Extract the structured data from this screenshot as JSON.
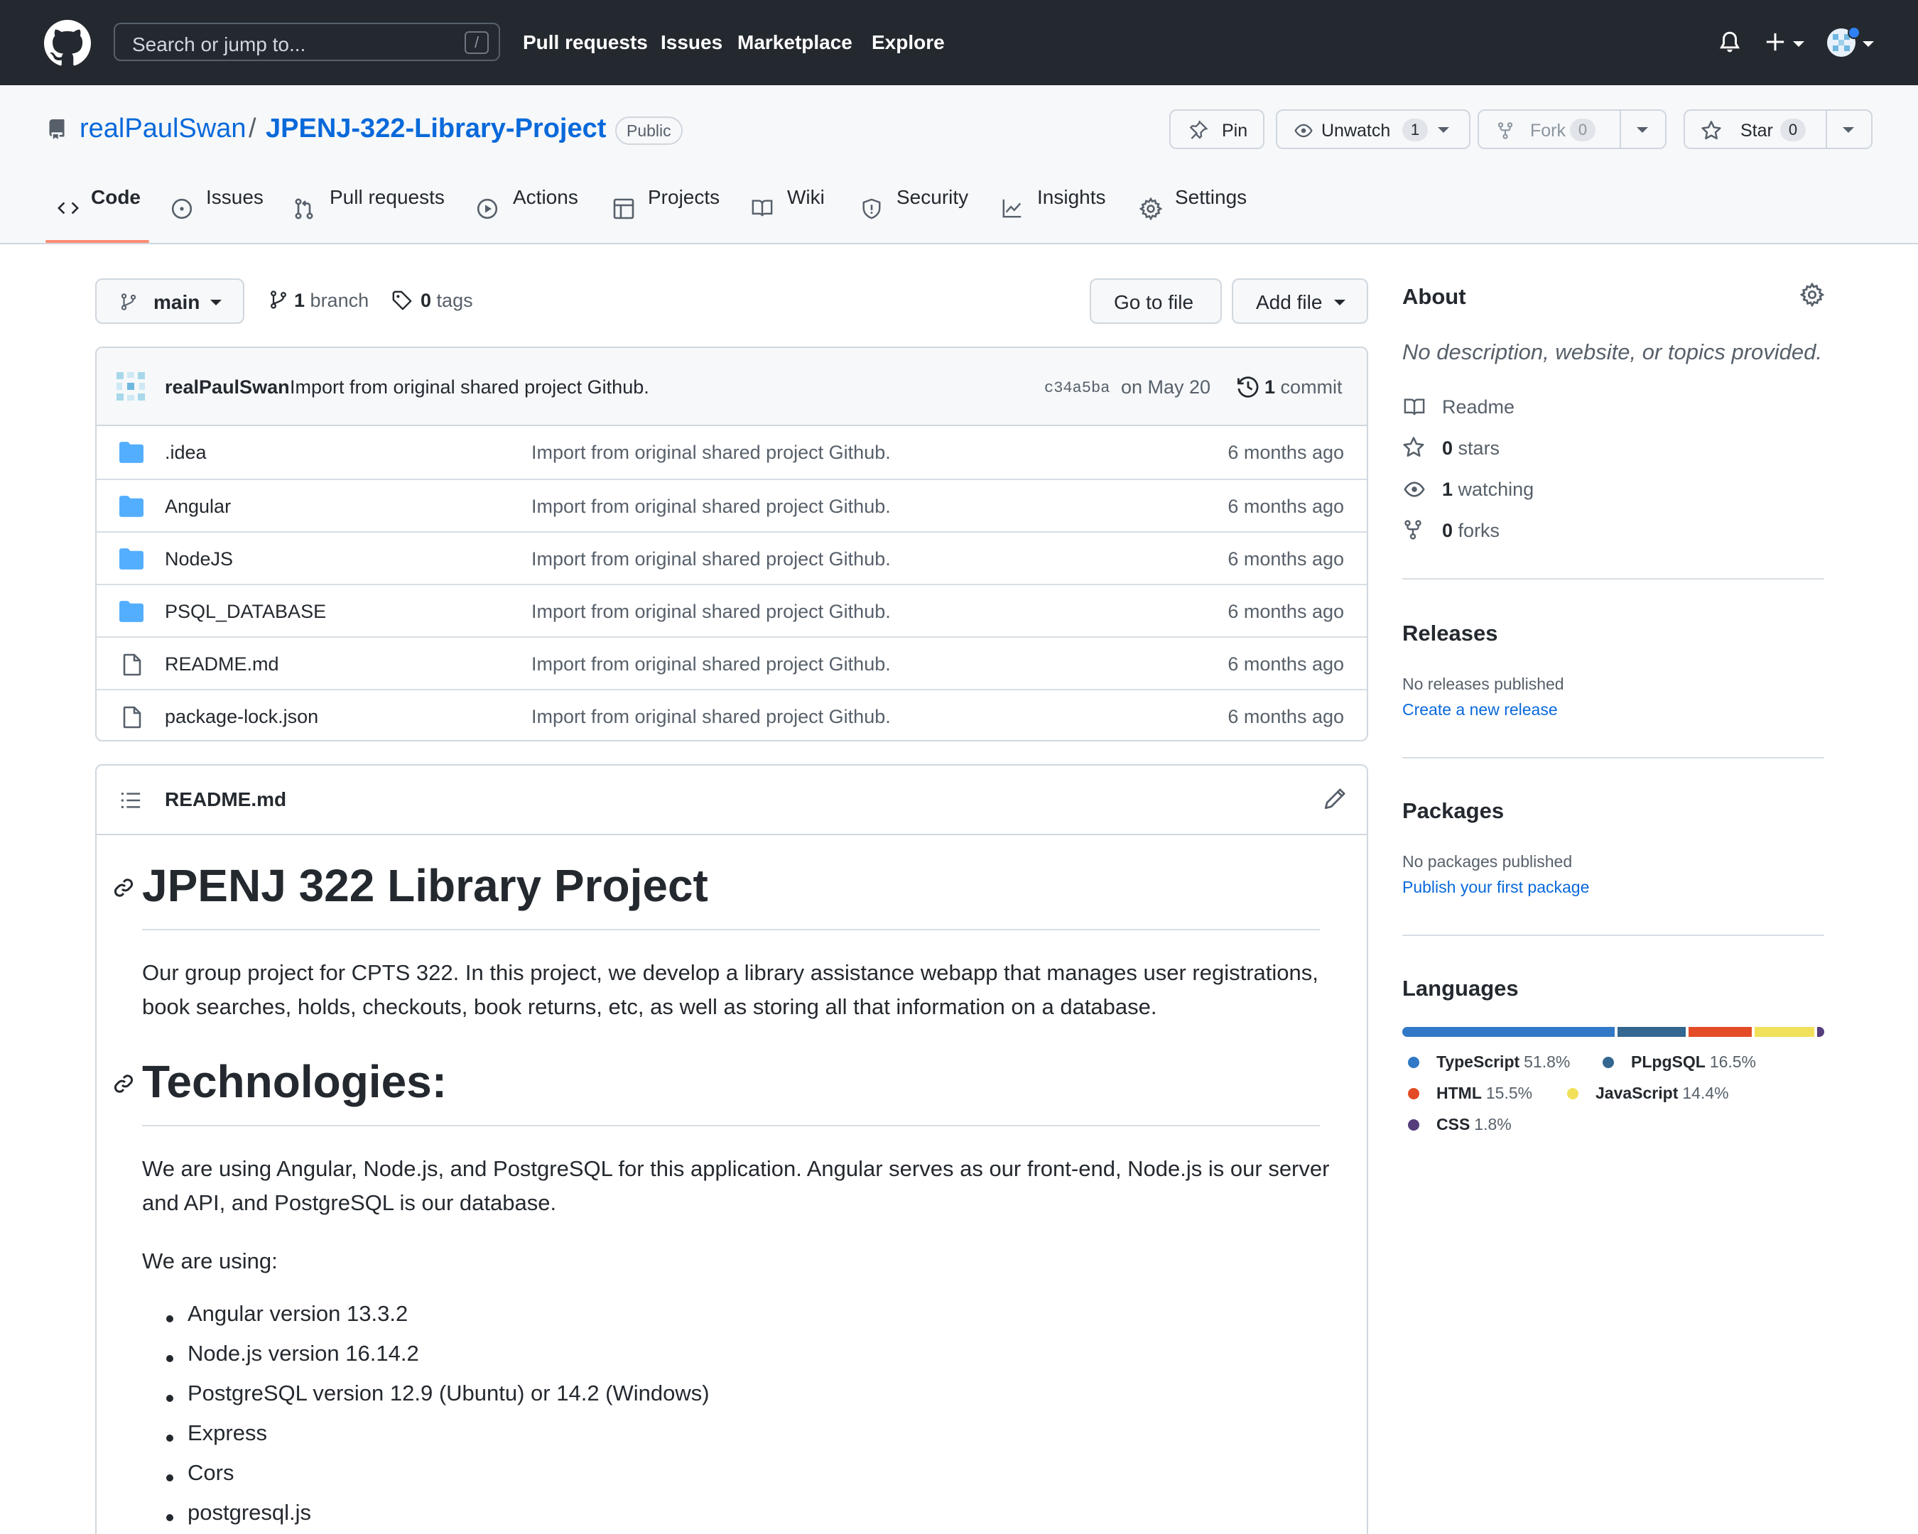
{
  "header": {
    "search_placeholder": "Search or jump to...",
    "search_shortcut": "/",
    "nav": [
      "Pull requests",
      "Issues",
      "Marketplace",
      "Explore"
    ]
  },
  "repo": {
    "owner": "realPaulSwan",
    "separator": "/",
    "name": "JPENJ-322-Library-Project",
    "visibility": "Public",
    "actions": {
      "pin": "Pin",
      "unwatch": "Unwatch",
      "watch_count": "1",
      "fork": "Fork",
      "fork_count": "0",
      "star": "Star",
      "star_count": "0"
    },
    "tabs": [
      "Code",
      "Issues",
      "Pull requests",
      "Actions",
      "Projects",
      "Wiki",
      "Security",
      "Insights",
      "Settings"
    ],
    "active_tab": "Code"
  },
  "filenav": {
    "branch": "main",
    "branch_count": "1",
    "branch_label": "branch",
    "tag_count": "0",
    "tag_label": "tags",
    "go_to_file": "Go to file",
    "add_file": "Add file"
  },
  "latest_commit": {
    "author": "realPaulSwan",
    "message": "Import from original shared project Github.",
    "sha": "c34a5ba",
    "date": "on May 20",
    "count": "1",
    "count_label": "commit"
  },
  "files": [
    {
      "name": ".idea",
      "type": "dir",
      "message": "Import from original shared project Github.",
      "age": "6 months ago"
    },
    {
      "name": "Angular",
      "type": "dir",
      "message": "Import from original shared project Github.",
      "age": "6 months ago"
    },
    {
      "name": "NodeJS",
      "type": "dir",
      "message": "Import from original shared project Github.",
      "age": "6 months ago"
    },
    {
      "name": "PSQL_DATABASE",
      "type": "dir",
      "message": "Import from original shared project Github.",
      "age": "6 months ago"
    },
    {
      "name": "README.md",
      "type": "file",
      "message": "Import from original shared project Github.",
      "age": "6 months ago"
    },
    {
      "name": "package-lock.json",
      "type": "file",
      "message": "Import from original shared project Github.",
      "age": "6 months ago"
    }
  ],
  "readme": {
    "filename": "README.md",
    "h1": "JPENJ 322 Library Project",
    "p1": "Our group project for CPTS 322. In this project, we develop a library assistance webapp that manages user registrations, book searches, holds, checkouts, book returns, etc, as well as storing all that information on a database.",
    "h2": "Technologies:",
    "p2": "We are using Angular, Node.js, and PostgreSQL for this application. Angular serves as our front-end, Node.js is our server and API, and PostgreSQL is our database.",
    "p3": "We are using:",
    "list": [
      "Angular version 13.3.2",
      "Node.js version 16.14.2",
      "PostgreSQL version 12.9 (Ubuntu) or 14.2 (Windows)",
      "Express",
      "Cors",
      "postgresql.js"
    ]
  },
  "sidebar": {
    "about_title": "About",
    "description": "No description, website, or topics provided.",
    "readme": "Readme",
    "stars_count": "0",
    "stars_label": "stars",
    "watching_count": "1",
    "watching_label": "watching",
    "forks_count": "0",
    "forks_label": "forks",
    "releases_title": "Releases",
    "releases_text": "No releases published",
    "releases_link": "Create a new release",
    "packages_title": "Packages",
    "packages_text": "No packages published",
    "packages_link": "Publish your first package",
    "languages_title": "Languages",
    "languages": [
      {
        "name": "TypeScript",
        "percent": "51.8%",
        "value": 51.8,
        "color": "#3178c6"
      },
      {
        "name": "PLpgSQL",
        "percent": "16.5%",
        "value": 16.5,
        "color": "#336790"
      },
      {
        "name": "HTML",
        "percent": "15.5%",
        "value": 15.5,
        "color": "#e34c26"
      },
      {
        "name": "JavaScript",
        "percent": "14.4%",
        "value": 14.4,
        "color": "#f1e05a"
      },
      {
        "name": "CSS",
        "percent": "1.8%",
        "value": 1.8,
        "color": "#563d7c"
      }
    ]
  },
  "colors": {
    "header_bg": "#24292f",
    "link": "#0969da",
    "active_tab_underline": "#fd8c73",
    "folder": "#54aeff"
  }
}
